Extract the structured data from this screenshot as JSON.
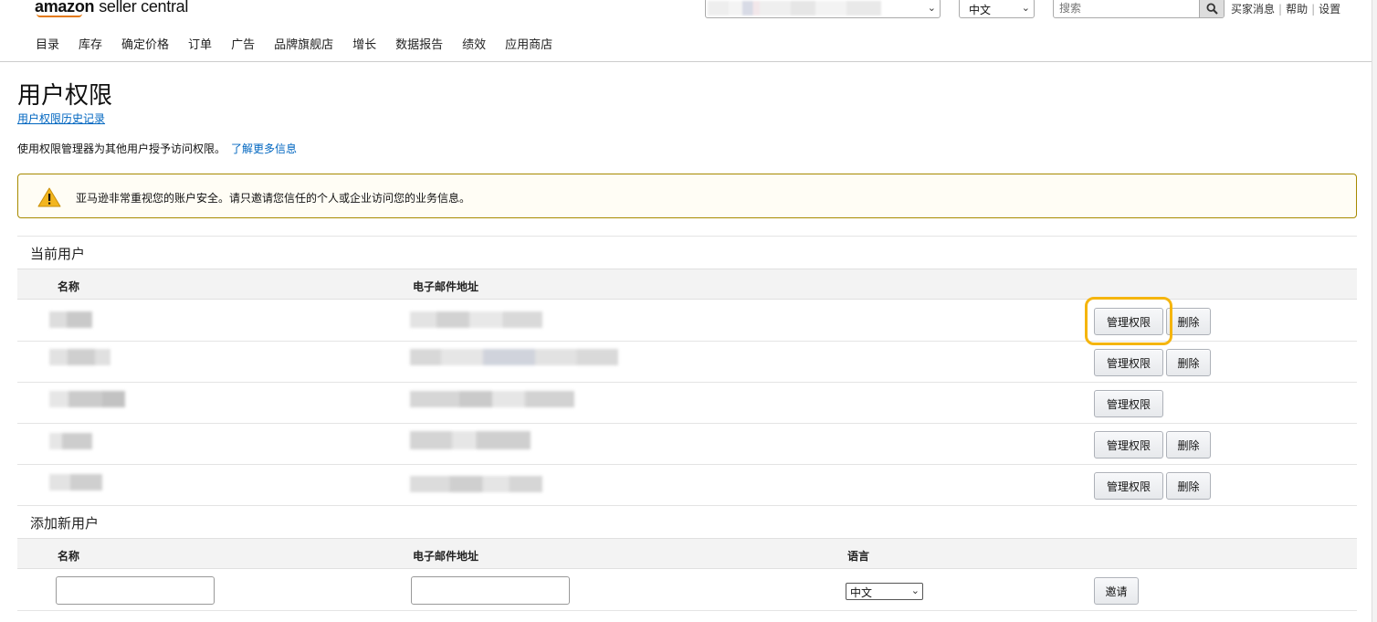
{
  "header": {
    "logo_brand": "amazon",
    "logo_product": "seller central",
    "language_selected": "中文",
    "search_placeholder": "搜索",
    "top_links": [
      "买家消息",
      "帮助",
      "设置"
    ]
  },
  "nav": [
    "目录",
    "库存",
    "确定价格",
    "订单",
    "广告",
    "品牌旗舰店",
    "增长",
    "数据报告",
    "绩效",
    "应用商店"
  ],
  "page": {
    "title": "用户权限",
    "history_link": "用户权限历史记录",
    "intro_text": "使用权限管理器为其他用户授予访问权限。",
    "learn_more": "了解更多信息"
  },
  "alert": {
    "icon": "warning-icon",
    "message": "亚马逊非常重视您的账户安全。请只邀请您信任的个人或企业访问您的业务信息。"
  },
  "current_users": {
    "title": "当前用户",
    "columns": {
      "name": "名称",
      "email": "电子邮件地址"
    },
    "manage_label": "管理权限",
    "delete_label": "删除",
    "rows": [
      {
        "has_delete": true
      },
      {
        "has_delete": true
      },
      {
        "has_delete": false
      },
      {
        "has_delete": true
      },
      {
        "has_delete": true
      }
    ]
  },
  "add_user": {
    "title": "添加新用户",
    "columns": {
      "name": "名称",
      "email": "电子邮件地址",
      "language": "语言"
    },
    "language_selected": "中文",
    "invite_label": "邀请"
  },
  "colors": {
    "link": "#0066c0",
    "highlight": "#f5b50e",
    "alert_border": "#a78a00",
    "logo_smile": "#e47911"
  }
}
